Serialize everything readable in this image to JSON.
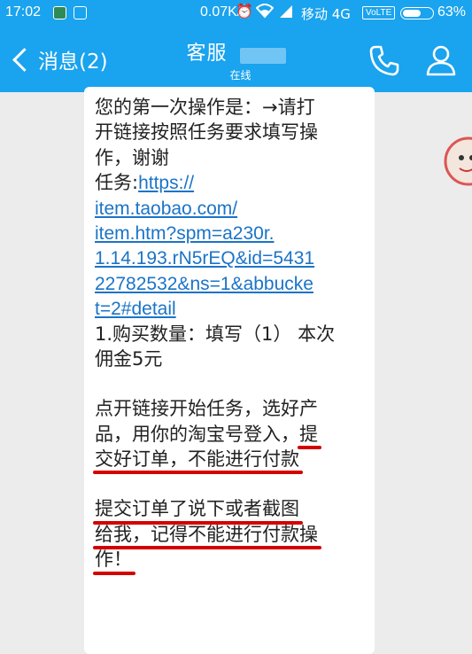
{
  "status_bar": {
    "time": "17:02",
    "net_speed": "0.07K/s",
    "carrier": "移动 4G",
    "volte": "VoLTE",
    "battery": "63%",
    "battery_level": 0.63
  },
  "header": {
    "back_label": "消息(2)",
    "title": "客服",
    "subtitle": "在线",
    "back_icon": "chevron-left-icon",
    "call_icon": "phone-icon",
    "profile_icon": "person-icon"
  },
  "message": {
    "lines": [
      "您的第一次操作是：→请打",
      "开链接按照任务要求填写操",
      "作，谢谢"
    ],
    "task_label": "任务:",
    "link_lines": [
      "https://",
      "item.taobao.com/",
      "item.htm?spm=a230r.",
      "1.14.193.rN5rEQ&id=5431",
      "22782532&ns=1&abbucke",
      "t=2#detail"
    ],
    "qty_lines": [
      "1.购买数量：填写（1） 本次",
      "佣金5元"
    ],
    "para2_line1": "点开链接开始任务，选好产",
    "para2_line2_prefix": "品，用你的淘宝号登入，",
    "para2_line2_underlined": "提",
    "para2_line3": "交好订单，不能进行付款",
    "para3_line1": "提交订单了说下或者截图",
    "para3_line2": "给我，记得不能进行付款操",
    "para3_line3": "作！"
  },
  "colors": {
    "brand_blue": "#1aa3ee",
    "link_blue": "#1b74c7",
    "underline_red": "#d40000"
  }
}
